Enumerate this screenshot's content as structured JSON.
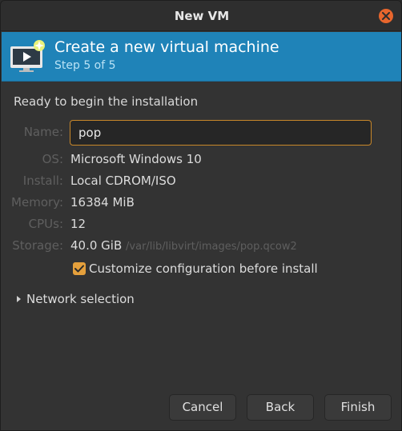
{
  "window": {
    "title": "New VM"
  },
  "banner": {
    "title": "Create a new virtual machine",
    "step": "Step 5 of 5"
  },
  "summary": {
    "heading": "Ready to begin the installation",
    "name_label": "Name:",
    "name_value": "pop",
    "os_label": "OS:",
    "os_value": "Microsoft Windows 10",
    "install_label": "Install:",
    "install_value": "Local CDROM/ISO",
    "memory_label": "Memory:",
    "memory_value": "16384 MiB",
    "cpus_label": "CPUs:",
    "cpus_value": "12",
    "storage_label": "Storage:",
    "storage_value": "40.0 GiB",
    "storage_path": "/var/lib/libvirt/images/pop.qcow2",
    "customize_label": "Customize configuration before install",
    "customize_checked": true
  },
  "network": {
    "label": "Network selection"
  },
  "buttons": {
    "cancel": "Cancel",
    "back": "Back",
    "finish": "Finish"
  },
  "colors": {
    "banner": "#1f83b8",
    "accent": "#e5a03c",
    "close": "#e8662d"
  }
}
